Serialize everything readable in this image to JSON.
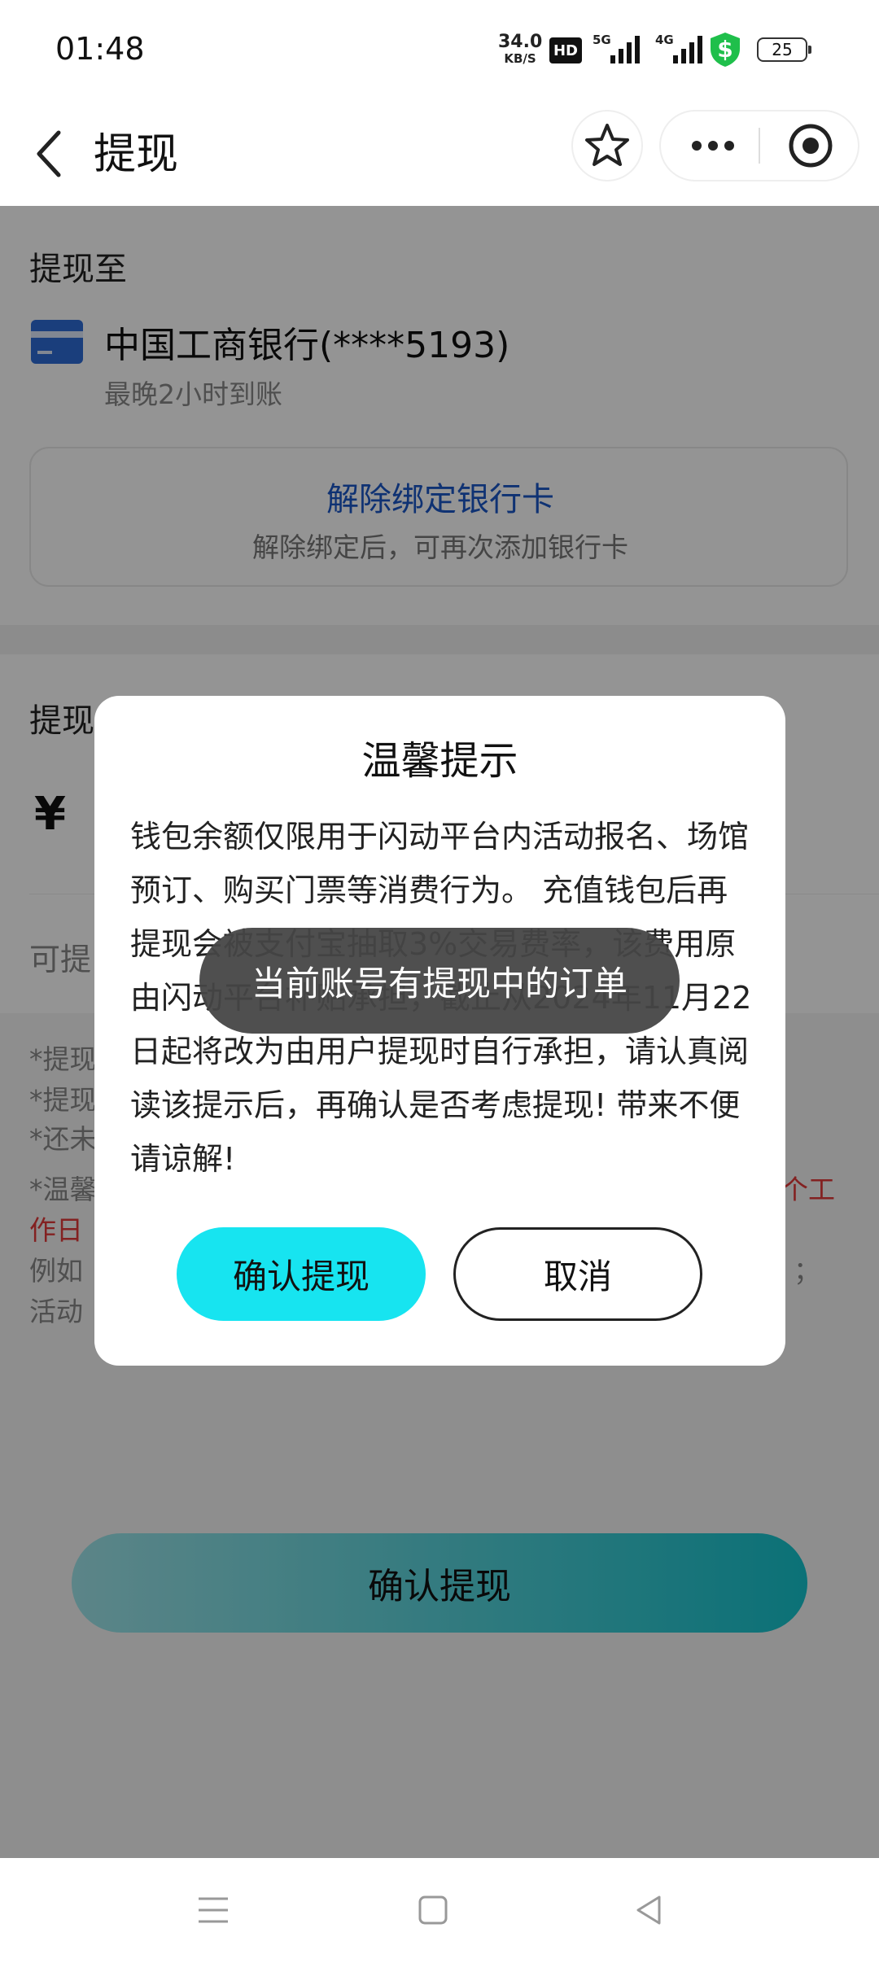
{
  "status_bar": {
    "time": "01:48",
    "net_speed_value": "34.0",
    "net_speed_unit": "KB/S",
    "hd_badge": "HD",
    "sig1_label": "5G",
    "sig2_label": "4G",
    "battery_level": "25",
    "shield_symbol": "$",
    "shield_color": "#1fbf4b"
  },
  "nav": {
    "title": "提现"
  },
  "withdraw_to": {
    "section_title": "提现至",
    "bank_name": "中国工商银行(****5193)",
    "arrival": "最晚2小时到账",
    "unbind_title": "解除绑定银行卡",
    "unbind_sub": "解除绑定后，可再次添加银行卡"
  },
  "amount": {
    "section_title_partial": "提现",
    "currency": "¥",
    "available_partial": "可提"
  },
  "notes": {
    "line1": "*提现",
    "line2": "*提现",
    "line3": "*还未",
    "line4_left": "*温馨",
    "line4_right": "个工",
    "line5": "作日",
    "line6_left": "例如",
    "line6_right": "；",
    "line7": "活动"
  },
  "bottom": {
    "confirm_label": "确认提现"
  },
  "dialog": {
    "title": "温馨提示",
    "body": "钱包余额仅限用于闪动平台内活动报名、场馆预订、购买门票等消费行为。 充值钱包后再提现会被支付宝抽取3%交易费率，该费用原由闪动平台补贴承担，截止从2024年11月22日起将改为由用户提现时自行承担，请认真阅读该提示后，再确认是否考虑提现! 带来不便请谅解!",
    "confirm_label": "确认提现",
    "cancel_label": "取消"
  },
  "toast": {
    "message": "当前账号有提现中的订单"
  },
  "colors": {
    "accent": "#17e4f0",
    "link": "#1a56c6",
    "warning": "#e23a3a",
    "bank_icon": "#2d6bd6"
  }
}
